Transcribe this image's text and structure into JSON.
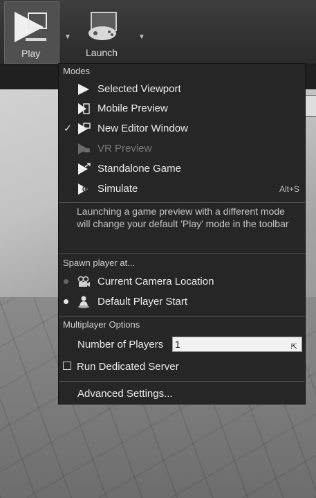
{
  "toolbar": {
    "play_label": "Play",
    "launch_label": "Launch"
  },
  "menu": {
    "modes_header": "Modes",
    "modes": [
      {
        "label": "Selected Viewport",
        "icon": "play-triangle-icon",
        "checked": false,
        "disabled": false,
        "shortcut": ""
      },
      {
        "label": "Mobile Preview",
        "icon": "mobile-preview-icon",
        "checked": false,
        "disabled": false,
        "shortcut": ""
      },
      {
        "label": "New Editor Window",
        "icon": "editor-window-icon",
        "checked": true,
        "disabled": false,
        "shortcut": ""
      },
      {
        "label": "VR Preview",
        "icon": "vr-preview-icon",
        "checked": false,
        "disabled": true,
        "shortcut": ""
      },
      {
        "label": "Standalone Game",
        "icon": "standalone-game-icon",
        "checked": false,
        "disabled": false,
        "shortcut": ""
      },
      {
        "label": "Simulate",
        "icon": "simulate-icon",
        "checked": false,
        "disabled": false,
        "shortcut": "Alt+S"
      }
    ],
    "check_glyph": "✓",
    "info_text": "Launching a game preview with a different mode will change your default 'Play' mode in the toolbar",
    "spawn_header": "Spawn player at...",
    "spawn_options": [
      {
        "label": "Current Camera Location",
        "icon": "camera-icon",
        "selected": false
      },
      {
        "label": "Default Player Start",
        "icon": "player-start-icon",
        "selected": true
      }
    ],
    "multiplayer_header": "Multiplayer Options",
    "players_label": "Number of Players",
    "players_value": "1",
    "dedicated_label": "Run Dedicated Server",
    "dedicated_checked": false,
    "advanced_label": "Advanced Settings..."
  },
  "colors": {
    "menu_bg": "#262626",
    "text": "#ececec",
    "disabled_text": "#7a7a7a"
  }
}
